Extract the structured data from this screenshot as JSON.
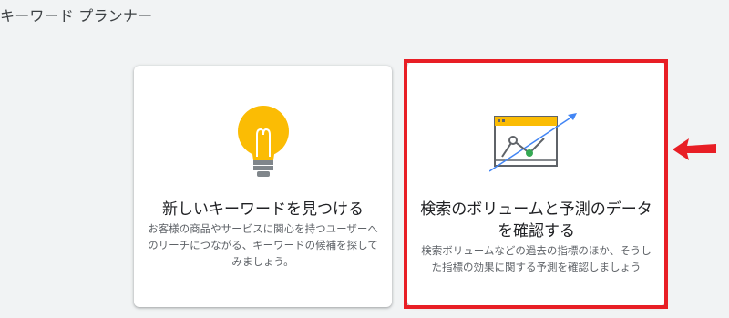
{
  "header": {
    "title": "キーワード プランナー"
  },
  "cards": {
    "discover": {
      "icon": "lightbulb-icon",
      "title": "新しいキーワードを見つける",
      "description": "お客様の商品やサービスに関心を持つユーザーへのリーチにつながる、キーワードの候補を探してみましょう。"
    },
    "forecast": {
      "icon": "forecast-chart-icon",
      "title": "検索のボリュームと予測のデータを確認する",
      "description": "検索ボリュームなどの過去の指標のほか、そうした指標の効果に関する予測を確認しましょう"
    }
  },
  "annotation": {
    "highlight_color": "#e81e25",
    "arrow_color": "#e81e25"
  },
  "colors": {
    "background": "#f1f3f4",
    "bulb_yellow": "#fbbc04",
    "bulb_base": "#80868b",
    "chart_blue": "#4285f4",
    "chart_green": "#34a853"
  }
}
